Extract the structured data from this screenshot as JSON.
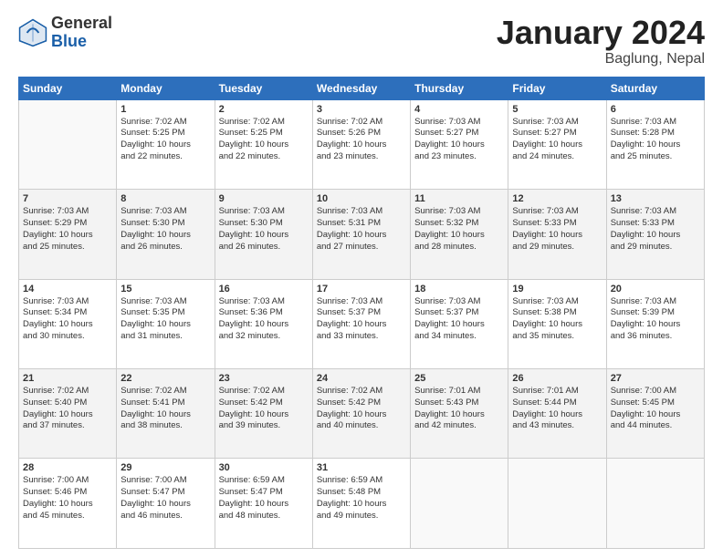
{
  "header": {
    "logo_general": "General",
    "logo_blue": "Blue",
    "month_title": "January 2024",
    "subtitle": "Baglung, Nepal"
  },
  "weekdays": [
    "Sunday",
    "Monday",
    "Tuesday",
    "Wednesday",
    "Thursday",
    "Friday",
    "Saturday"
  ],
  "weeks": [
    [
      {
        "day": "",
        "info": ""
      },
      {
        "day": "1",
        "info": "Sunrise: 7:02 AM\nSunset: 5:25 PM\nDaylight: 10 hours\nand 22 minutes."
      },
      {
        "day": "2",
        "info": "Sunrise: 7:02 AM\nSunset: 5:25 PM\nDaylight: 10 hours\nand 22 minutes."
      },
      {
        "day": "3",
        "info": "Sunrise: 7:02 AM\nSunset: 5:26 PM\nDaylight: 10 hours\nand 23 minutes."
      },
      {
        "day": "4",
        "info": "Sunrise: 7:03 AM\nSunset: 5:27 PM\nDaylight: 10 hours\nand 23 minutes."
      },
      {
        "day": "5",
        "info": "Sunrise: 7:03 AM\nSunset: 5:27 PM\nDaylight: 10 hours\nand 24 minutes."
      },
      {
        "day": "6",
        "info": "Sunrise: 7:03 AM\nSunset: 5:28 PM\nDaylight: 10 hours\nand 25 minutes."
      }
    ],
    [
      {
        "day": "7",
        "info": "Sunrise: 7:03 AM\nSunset: 5:29 PM\nDaylight: 10 hours\nand 25 minutes."
      },
      {
        "day": "8",
        "info": "Sunrise: 7:03 AM\nSunset: 5:30 PM\nDaylight: 10 hours\nand 26 minutes."
      },
      {
        "day": "9",
        "info": "Sunrise: 7:03 AM\nSunset: 5:30 PM\nDaylight: 10 hours\nand 26 minutes."
      },
      {
        "day": "10",
        "info": "Sunrise: 7:03 AM\nSunset: 5:31 PM\nDaylight: 10 hours\nand 27 minutes."
      },
      {
        "day": "11",
        "info": "Sunrise: 7:03 AM\nSunset: 5:32 PM\nDaylight: 10 hours\nand 28 minutes."
      },
      {
        "day": "12",
        "info": "Sunrise: 7:03 AM\nSunset: 5:33 PM\nDaylight: 10 hours\nand 29 minutes."
      },
      {
        "day": "13",
        "info": "Sunrise: 7:03 AM\nSunset: 5:33 PM\nDaylight: 10 hours\nand 29 minutes."
      }
    ],
    [
      {
        "day": "14",
        "info": "Sunrise: 7:03 AM\nSunset: 5:34 PM\nDaylight: 10 hours\nand 30 minutes."
      },
      {
        "day": "15",
        "info": "Sunrise: 7:03 AM\nSunset: 5:35 PM\nDaylight: 10 hours\nand 31 minutes."
      },
      {
        "day": "16",
        "info": "Sunrise: 7:03 AM\nSunset: 5:36 PM\nDaylight: 10 hours\nand 32 minutes."
      },
      {
        "day": "17",
        "info": "Sunrise: 7:03 AM\nSunset: 5:37 PM\nDaylight: 10 hours\nand 33 minutes."
      },
      {
        "day": "18",
        "info": "Sunrise: 7:03 AM\nSunset: 5:37 PM\nDaylight: 10 hours\nand 34 minutes."
      },
      {
        "day": "19",
        "info": "Sunrise: 7:03 AM\nSunset: 5:38 PM\nDaylight: 10 hours\nand 35 minutes."
      },
      {
        "day": "20",
        "info": "Sunrise: 7:03 AM\nSunset: 5:39 PM\nDaylight: 10 hours\nand 36 minutes."
      }
    ],
    [
      {
        "day": "21",
        "info": "Sunrise: 7:02 AM\nSunset: 5:40 PM\nDaylight: 10 hours\nand 37 minutes."
      },
      {
        "day": "22",
        "info": "Sunrise: 7:02 AM\nSunset: 5:41 PM\nDaylight: 10 hours\nand 38 minutes."
      },
      {
        "day": "23",
        "info": "Sunrise: 7:02 AM\nSunset: 5:42 PM\nDaylight: 10 hours\nand 39 minutes."
      },
      {
        "day": "24",
        "info": "Sunrise: 7:02 AM\nSunset: 5:42 PM\nDaylight: 10 hours\nand 40 minutes."
      },
      {
        "day": "25",
        "info": "Sunrise: 7:01 AM\nSunset: 5:43 PM\nDaylight: 10 hours\nand 42 minutes."
      },
      {
        "day": "26",
        "info": "Sunrise: 7:01 AM\nSunset: 5:44 PM\nDaylight: 10 hours\nand 43 minutes."
      },
      {
        "day": "27",
        "info": "Sunrise: 7:00 AM\nSunset: 5:45 PM\nDaylight: 10 hours\nand 44 minutes."
      }
    ],
    [
      {
        "day": "28",
        "info": "Sunrise: 7:00 AM\nSunset: 5:46 PM\nDaylight: 10 hours\nand 45 minutes."
      },
      {
        "day": "29",
        "info": "Sunrise: 7:00 AM\nSunset: 5:47 PM\nDaylight: 10 hours\nand 46 minutes."
      },
      {
        "day": "30",
        "info": "Sunrise: 6:59 AM\nSunset: 5:47 PM\nDaylight: 10 hours\nand 48 minutes."
      },
      {
        "day": "31",
        "info": "Sunrise: 6:59 AM\nSunset: 5:48 PM\nDaylight: 10 hours\nand 49 minutes."
      },
      {
        "day": "",
        "info": ""
      },
      {
        "day": "",
        "info": ""
      },
      {
        "day": "",
        "info": ""
      }
    ]
  ]
}
